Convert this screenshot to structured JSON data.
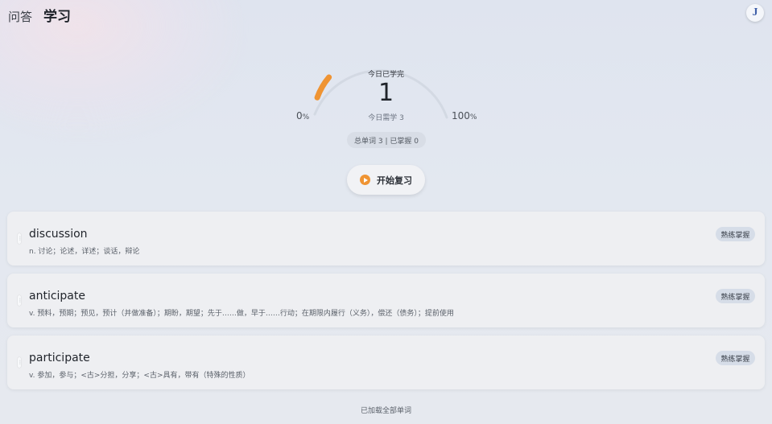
{
  "header": {
    "tab_qa": "问答",
    "tab_learn": "学习",
    "avatar_letter": "J"
  },
  "progress": {
    "title": "今日已学完",
    "value": "1",
    "subtitle": "今日需学 3",
    "min_label": "0",
    "max_label": "100",
    "percent_sign": "%",
    "fraction": 0.1,
    "accent_color": "#ef9433"
  },
  "summary": {
    "text": "总单词 3 | 已掌握 0"
  },
  "review_button": {
    "label": "开始复习",
    "icon": "play-icon"
  },
  "words": [
    {
      "word": "discussion",
      "definition": "n. 讨论；论述，详述；谈话，辩论",
      "badge": "熟练掌握"
    },
    {
      "word": "anticipate",
      "definition": "v. 预料，预期；预见，预计（并做准备）；期盼，期望；先于……做，早于……行动；在期限内履行（义务），偿还（债务）；提前使用",
      "badge": "熟练掌握"
    },
    {
      "word": "participate",
      "definition": "v. 参加，参与；<古>分担，分享；<古>具有，带有（特殊的性质）",
      "badge": "熟练掌握"
    }
  ],
  "footer": {
    "text": "已加载全部单词"
  }
}
